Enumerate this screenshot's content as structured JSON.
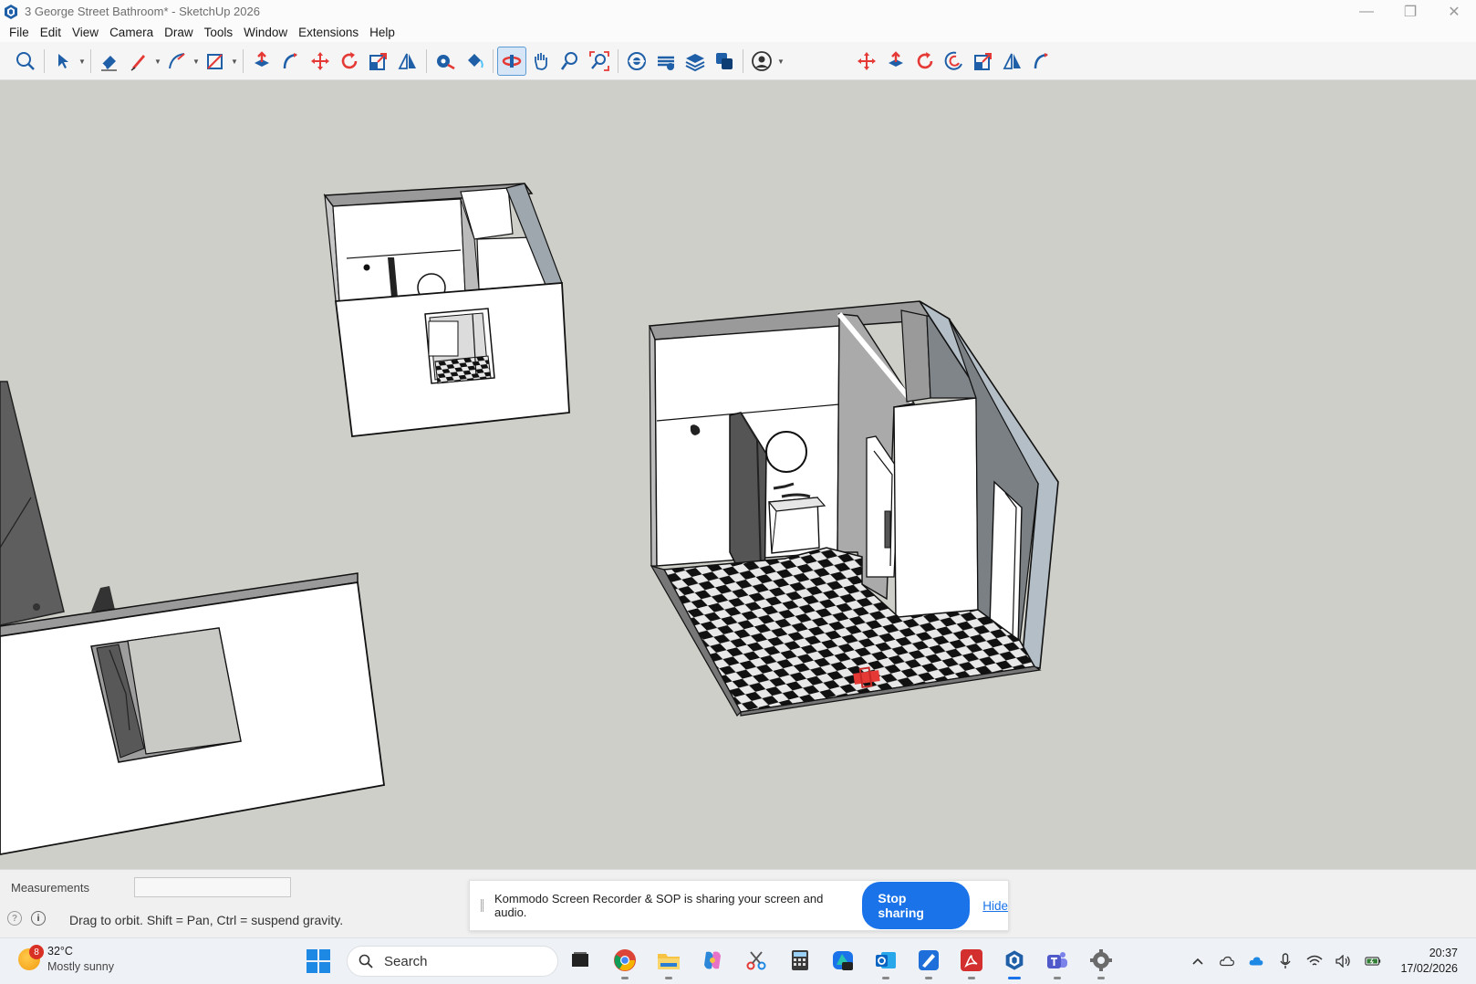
{
  "window": {
    "title": "3 George Street Bathroom* - SketchUp 2026",
    "minimize": "—",
    "restore": "❐",
    "close": "✕"
  },
  "menu": [
    "File",
    "Edit",
    "View",
    "Camera",
    "Draw",
    "Tools",
    "Window",
    "Extensions",
    "Help"
  ],
  "toolbar": {
    "tools": [
      "search",
      "select",
      "eraser",
      "pencil-line",
      "arc",
      "rectangle",
      "push-pull",
      "follow-me",
      "move",
      "rotate",
      "scale",
      "flip",
      "tape-measure",
      "paint-bucket",
      "orbit",
      "pan",
      "zoom",
      "zoom-extents",
      "section-plane",
      "section-display",
      "section-fill",
      "solid-tools",
      "account",
      "move-2",
      "push-pull-2",
      "rotate-2",
      "offset",
      "scale-2",
      "flip-2",
      "follow-me-2"
    ],
    "active_tool": "orbit"
  },
  "status": {
    "measurements_label": "Measurements",
    "measurements_value": "",
    "hint": "Drag to orbit. Shift = Pan, Ctrl = suspend gravity."
  },
  "share_banner": {
    "message": "Kommodo Screen Recorder & SOP is sharing your screen and audio.",
    "stop_label": "Stop sharing",
    "hide_label": "Hide"
  },
  "taskbar": {
    "weather_badge": "8",
    "temperature": "32°C",
    "weather": "Mostly sunny",
    "search_placeholder": "Search",
    "time": "20:37",
    "date": "17/02/2026",
    "apps": [
      "file-explorer-window",
      "chrome",
      "folder",
      "copilot",
      "snipping-tool",
      "calculator",
      "m365",
      "outlook",
      "whiteboard",
      "acrobat",
      "sketchup",
      "teams",
      "settings"
    ]
  }
}
